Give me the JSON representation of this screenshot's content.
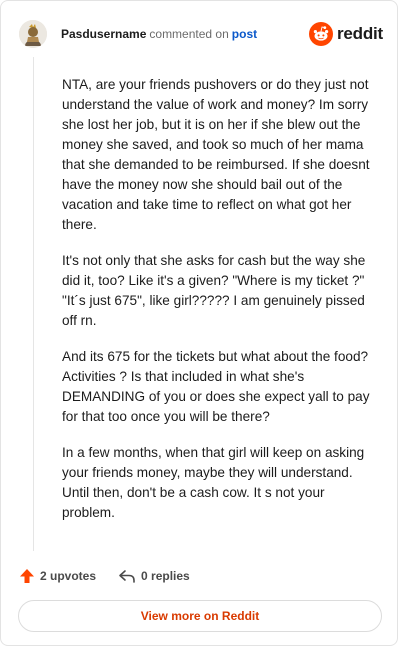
{
  "header": {
    "username": "Pasdusername",
    "action": "commented on",
    "post_link": "post",
    "brand": "reddit"
  },
  "comment": {
    "paragraphs": [
      "NTA, are your friends pushovers or do they just not understand the value of work and money? Im sorry she lost her job, but it is on her if she blew out the money she saved, and took so much of her mama that she demanded to be reimbursed. If she doesnt have the money now she should bail out of the vacation and take time to reflect on what got her there.",
      "It's not only that she asks for cash but the way she did it, too? Like it's a given? \"Where is my ticket ?\" \"It´s just 675\", like girl????? I am genuinely pissed off rn.",
      "And its 675 for the tickets but what about the food? Activities ? Is that included in what she's DEMANDING of you or does she expect yall to pay for that too once you will be there?",
      "In a few months, when that girl will keep on asking your friends money, maybe they will understand. Until then, don't be a cash cow. It s not your problem."
    ]
  },
  "footer": {
    "upvotes": "2 upvotes",
    "replies": "0 replies",
    "view_more": "View more on Reddit"
  },
  "colors": {
    "brand_orange": "#ff4500",
    "link_blue": "#0a58ca",
    "cta_text": "#d93a00"
  },
  "icons": {
    "avatar": "user-avatar",
    "brand": "reddit-snoo-icon",
    "upvote": "upvote-arrow-icon",
    "reply": "reply-arrow-icon"
  }
}
